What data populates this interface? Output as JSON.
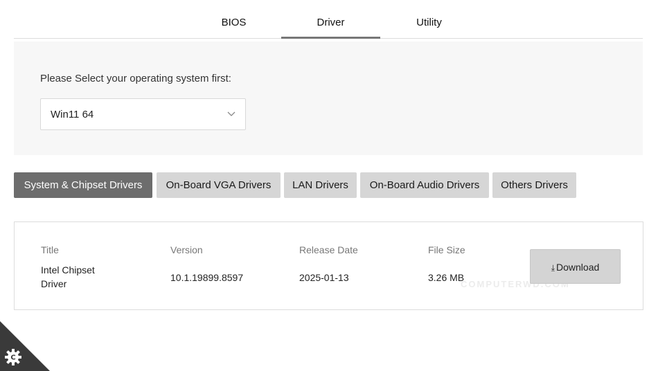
{
  "top_tabs": [
    {
      "label": "BIOS",
      "active": false
    },
    {
      "label": "Driver",
      "active": true
    },
    {
      "label": "Utility",
      "active": false
    }
  ],
  "os_panel": {
    "label": "Please Select your operating system first:",
    "selected": "Win11 64"
  },
  "categories": [
    {
      "label": "System & Chipset Drivers",
      "active": true
    },
    {
      "label": "On-Board VGA Drivers",
      "active": false
    },
    {
      "label": "LAN Drivers",
      "active": false
    },
    {
      "label": "On-Board Audio Drivers",
      "active": false
    },
    {
      "label": "Others Drivers",
      "active": false
    }
  ],
  "table": {
    "headers": {
      "title": "Title",
      "version": "Version",
      "release_date": "Release Date",
      "file_size": "File Size"
    },
    "rows": [
      {
        "title": "Intel Chipset Driver",
        "version": "10.1.19899.8597",
        "release_date": "2025-01-13",
        "file_size": "3.26 MB",
        "action": "Download"
      }
    ]
  },
  "watermark": "COMPUTERWD.COM",
  "colors": {
    "active_tab_bg": "#6d6d6d",
    "inactive_tab_bg": "#d6d6d6",
    "panel_bg": "#f7f7f7",
    "corner_badge": "#3a3a3a"
  },
  "icons": {
    "select_chevron": "chevron-down-icon",
    "download": "download-arrow-icon",
    "corner": "gear-icon"
  }
}
